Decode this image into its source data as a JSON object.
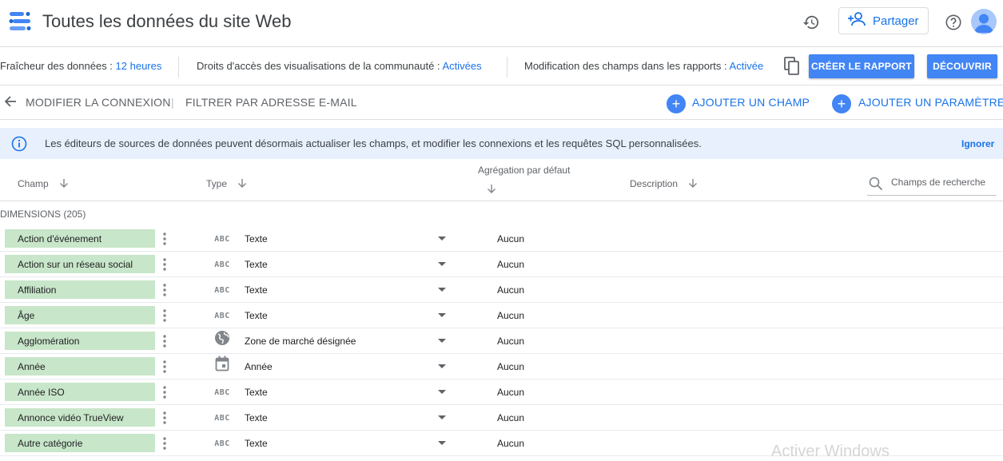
{
  "header": {
    "title": "Toutes les données du site Web",
    "share_label": "Partager"
  },
  "infobar": {
    "freshness_label": "Fraîcheur des données :",
    "freshness_value": "12 heures",
    "access_label": "Droits d'accès des visualisations de la communauté :",
    "access_value": "Activées",
    "edit_label": "Modification des champs dans les rapports :",
    "edit_value": "Activée",
    "create_report": "CRÉER LE RAPPORT",
    "discover": "DÉCOUVRIR"
  },
  "actionbar": {
    "edit_connection": "MODIFIER LA CONNEXION",
    "separator": "|",
    "filter_email": "FILTRER PAR ADRESSE E-MAIL",
    "add_field": "AJOUTER UN CHAMP",
    "add_param": "AJOUTER UN PARAMÈTRE"
  },
  "banner": {
    "message": "Les éditeurs de sources de données peuvent désormais actualiser les champs, et modifier les connexions et les requêtes SQL personnalisées.",
    "dismiss": "Ignorer"
  },
  "columns": {
    "field": "Champ",
    "type": "Type",
    "aggregation": "Agrégation par défaut",
    "description": "Description",
    "search_placeholder": "Champs de recherche"
  },
  "section": {
    "label": "DIMENSIONS (205)"
  },
  "rows": [
    {
      "name": "Action d'événement",
      "type_icon": "abc-icon",
      "type": "Texte",
      "aggregation": "Aucun"
    },
    {
      "name": "Action sur un réseau social",
      "type_icon": "abc-icon",
      "type": "Texte",
      "aggregation": "Aucun"
    },
    {
      "name": "Affiliation",
      "type_icon": "abc-icon",
      "type": "Texte",
      "aggregation": "Aucun"
    },
    {
      "name": "Âge",
      "type_icon": "abc-icon",
      "type": "Texte",
      "aggregation": "Aucun"
    },
    {
      "name": "Agglomération",
      "type_icon": "globe-icon",
      "type": "Zone de marché désignée",
      "aggregation": "Aucun"
    },
    {
      "name": "Année",
      "type_icon": "calendar-icon",
      "type": "Année",
      "aggregation": "Aucun"
    },
    {
      "name": "Année ISO",
      "type_icon": "abc-icon",
      "type": "Texte",
      "aggregation": "Aucun"
    },
    {
      "name": "Annonce vidéo TrueView",
      "type_icon": "abc-icon",
      "type": "Texte",
      "aggregation": "Aucun"
    },
    {
      "name": "Autre catégorie",
      "type_icon": "abc-icon",
      "type": "Texte",
      "aggregation": "Aucun"
    }
  ],
  "abc_text": "ABC",
  "watermark": "Activer Windows",
  "colors": {
    "accent": "#1a73e8",
    "button": "#4285f4",
    "chip": "#c8e6c9",
    "banner": "#e8f0fe"
  }
}
